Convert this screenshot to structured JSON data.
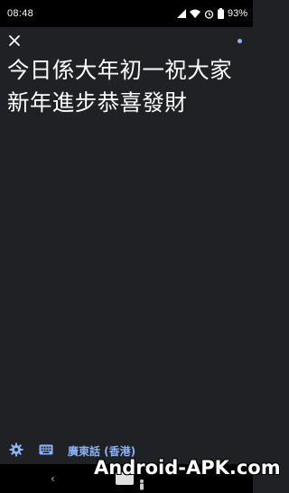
{
  "status_bar": {
    "time": "08:48",
    "battery": "93%",
    "icons": [
      "signal-icon",
      "wifi-icon",
      "alarm-icon",
      "battery-icon"
    ]
  },
  "top_bar": {
    "close_icon": "close-icon",
    "indicator_color": "#8ab4f8"
  },
  "transcript": {
    "text": "今日係大年初一祝大家新年進步恭喜發財"
  },
  "bottom_bar": {
    "settings_icon": "gear-icon",
    "keyboard_icon": "keyboard-icon",
    "language": "廣東話 (香港)",
    "accent_color": "#8ab4f8"
  },
  "nav_bar": {
    "back_glyph": "‹"
  },
  "watermark": {
    "text": "Android-APK.com"
  }
}
